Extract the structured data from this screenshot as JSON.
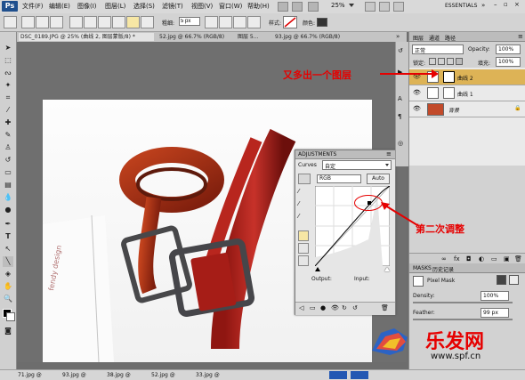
{
  "menubar": {
    "logo": "Ps",
    "items": [
      "文件(F)",
      "编辑(E)",
      "图像(I)",
      "图层(L)",
      "选择(S)",
      "滤镜(T)",
      "视图(V)",
      "窗口(W)",
      "帮助(H)"
    ],
    "zoom": "25%",
    "workspace": "ESSENTIALS"
  },
  "options": {
    "feather_label": "粗细:",
    "feather_value": "5 px",
    "style_label": "样式:",
    "color_label": "颜色:"
  },
  "tabs": {
    "active": "DSC_0189.JPG @ 25% (曲线 2, 图层蒙版/8) *",
    "others": [
      "52.jpg @ 66.7% (RGB/8)",
      "图层 5...",
      "93.jpg @ 66.7% (RGB/8)"
    ]
  },
  "layers": {
    "blend_mode": "正常",
    "opacity_label": "Opacity:",
    "opacity_value": "100%",
    "lock_label": "锁定:",
    "fill_label": "填充:",
    "fill_value": "100%",
    "rows": [
      {
        "name": "曲线 2",
        "selected": true
      },
      {
        "name": "曲线 1",
        "selected": false
      },
      {
        "name": "背景",
        "selected": false
      }
    ]
  },
  "adjustments": {
    "title": "ADJUSTMENTS",
    "curves_label": "Curves",
    "preset": "自定",
    "channel": "RGB",
    "auto_label": "Auto",
    "output_label": "Output:",
    "input_label": "Input:"
  },
  "masks": {
    "title_a": "MASKS",
    "title_b": "历史记录",
    "pixel_mask": "Pixel Mask",
    "density_label": "Density:",
    "density_value": "100%",
    "feather_label": "Feather:",
    "feather_value": "99 px"
  },
  "annotations": {
    "layer_note": "又多出一个图层",
    "curve_note": "第二次调整"
  },
  "taskbar": {
    "items": [
      "71.jpg @",
      "93.jpg @",
      "38.jpg @",
      "52.jpg @",
      "33.jpg @"
    ]
  },
  "watermark": {
    "logo": "乐发网",
    "url": "www.spf.cn"
  },
  "colors": {
    "annotation_red": "#e60000",
    "selected_layer": "#ddb356",
    "panel_bg": "#d2d2d2"
  }
}
